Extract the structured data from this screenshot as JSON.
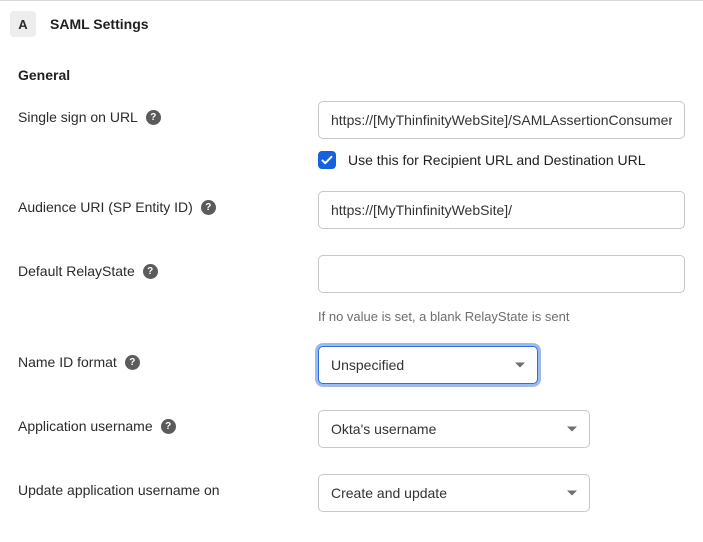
{
  "section": {
    "step_letter": "A",
    "title": "SAML Settings"
  },
  "general": {
    "heading": "General",
    "sso_url": {
      "label": "Single sign on URL",
      "value": "https://[MyThinfinityWebSite]/SAMLAssertionConsumerService",
      "checkbox_label": "Use this for Recipient URL and Destination URL",
      "checkbox_checked": true
    },
    "audience_uri": {
      "label": "Audience URI (SP Entity ID)",
      "value": "https://[MyThinfinityWebSite]/"
    },
    "default_relaystate": {
      "label": "Default RelayState",
      "value": "",
      "helper": "If no value is set, a blank RelayState is sent"
    },
    "name_id_format": {
      "label": "Name ID format",
      "selected": "Unspecified"
    },
    "application_username": {
      "label": "Application username",
      "selected": "Okta's username"
    },
    "update_username_on": {
      "label": "Update application username on",
      "selected": "Create and update"
    }
  },
  "glyphs": {
    "help": "?"
  }
}
